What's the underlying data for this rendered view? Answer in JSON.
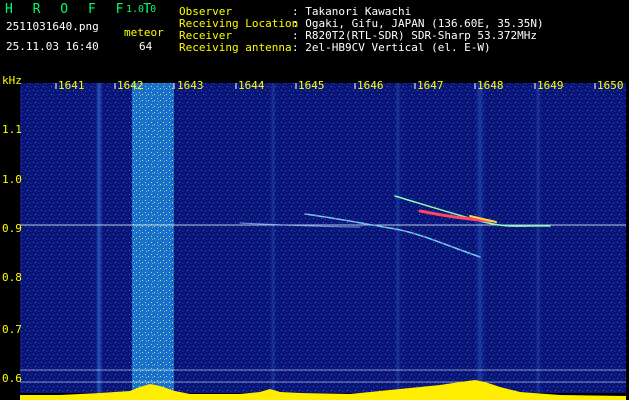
{
  "header": {
    "brand": "H R O F F T",
    "version": "1.0.0",
    "filename": "2511031640.png",
    "datetime": "25.11.03 16:40",
    "meteor_label": "meteor",
    "meteor_count": "64"
  },
  "info": [
    {
      "label": "Observer",
      "value": ": Takanori Kawachi"
    },
    {
      "label": "Receiving Location",
      "value": ": Ogaki, Gifu, JAPAN (136.60E, 35.35N)"
    },
    {
      "label": "Receiver",
      "value": ": R820T2(RTL-SDR) SDR-Sharp 53.372MHz"
    },
    {
      "label": "Receiving antenna",
      "value": ": 2el-HB9CV Vertical (el. E-W)"
    }
  ],
  "axes": {
    "y_unit": "kHz",
    "x_ticks": [
      "1641",
      "1642",
      "1643",
      "1644",
      "1645",
      "1646",
      "1647",
      "1648",
      "1649",
      "1650"
    ],
    "y_ticks": [
      "1.1",
      "1.0",
      "0.9",
      "0.8",
      "0.7",
      "0.6"
    ]
  },
  "colors": {
    "background": "#000000",
    "label": "#ffff00",
    "text": "#ffffff",
    "brand": "#00ff66",
    "noise": "#1a2a9a",
    "carrier": "#e8f8ff",
    "trail": "#ff4466"
  }
}
